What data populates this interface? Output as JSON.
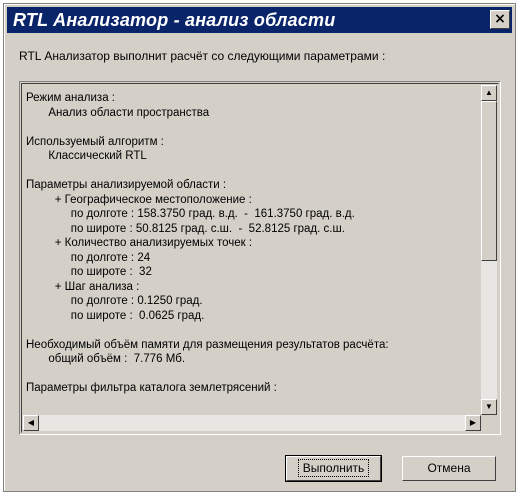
{
  "window": {
    "title": "RTL Анализатор - анализ области",
    "close_glyph": "×"
  },
  "intro_text": "RTL Анализатор выполнит расчёт со следующими параметрами :",
  "memo_lines": [
    "Режим анализа :",
    "       Анализ области пространства",
    "",
    "Используемый алгоритм :",
    "       Классический RTL",
    "",
    "Параметры анализируемой области :",
    "         + Географическое местоположение :",
    "              по долготе : 158.3750 град. в.д.  -  161.3750 град. в.д.",
    "              по широте : 50.8125 град. с.ш.  -  52.8125 град. с.ш.",
    "         + Количество анализируемых точек :",
    "              по долготе : 24",
    "              по широте :  32",
    "         + Шаг анализа :",
    "              по долготе : 0.1250 град.",
    "              по широте :  0.0625 град.",
    "",
    "Необходимый объём памяти для размещения результатов расчёта:",
    "       общий объём :  7.776 Мб.",
    "",
    "Параметры фильтра каталога землетрясений :"
  ],
  "buttons": {
    "run": "Выполнить",
    "cancel": "Отмена"
  },
  "scrollbar": {
    "up": "▲",
    "down": "▼",
    "left": "◀",
    "right": "▶",
    "vertical_position": 0.0,
    "horizontal_position": 0.0
  }
}
